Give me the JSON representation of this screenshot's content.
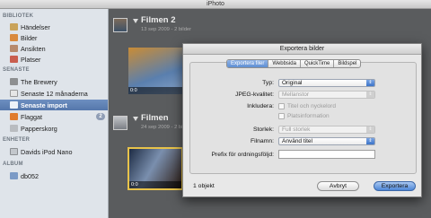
{
  "window": {
    "title": "iPhoto"
  },
  "sidebar": {
    "sections": [
      {
        "label": "BIBLIOTEK"
      },
      {
        "label": "SENASTE"
      },
      {
        "label": "ENHETER"
      },
      {
        "label": "ALBUM"
      }
    ],
    "items": [
      {
        "label": "Händelser",
        "icon": "events-icon"
      },
      {
        "label": "Bilder",
        "icon": "photos-icon"
      },
      {
        "label": "Ansikten",
        "icon": "faces-icon"
      },
      {
        "label": "Platser",
        "icon": "places-icon"
      },
      {
        "label": "The Brewery",
        "icon": "event-icon"
      },
      {
        "label": "Senaste 12 månaderna",
        "icon": "calendar-icon"
      },
      {
        "label": "Senaste import",
        "icon": "import-icon"
      },
      {
        "label": "Flaggat",
        "icon": "flag-icon",
        "badge": "2"
      },
      {
        "label": "Papperskorg",
        "icon": "trash-icon"
      },
      {
        "label": "Davids iPod Nano",
        "icon": "ipod-icon"
      },
      {
        "label": "db052",
        "icon": "album-icon"
      }
    ]
  },
  "events": [
    {
      "title": "Filmen 2",
      "subtitle": "13 sep 2009 - 2 bilder",
      "photo_meta": "0:0"
    },
    {
      "title": "Filmen",
      "subtitle": "24 sep 2009 - 2 bilder",
      "photo_meta": "0:0"
    }
  ],
  "dialog": {
    "title": "Exportera bilder",
    "tabs": [
      "Exportera filer",
      "Webbsida",
      "QuickTime",
      "Bildspel"
    ],
    "active_tab": "Exportera filer",
    "fields": {
      "typ_label": "Typ:",
      "typ_value": "Original",
      "jpeg_label": "JPEG-kvalitet:",
      "jpeg_value": "Mellanstor",
      "include_label": "Inkludera:",
      "include_title_keywords": "Titel och nyckelord",
      "include_location": "Platsinformation",
      "size_label": "Storlek:",
      "size_value": "Full storlek",
      "filename_label": "Filnamn:",
      "filename_value": "Använd titel",
      "prefix_label": "Prefix för ordningsföljd:",
      "prefix_value": ""
    },
    "footer_text": "1 objekt",
    "cancel_label": "Avbryt",
    "export_label": "Exportera"
  },
  "colors": {
    "selection": "#5f81b6",
    "accent": "#4d86d6"
  }
}
